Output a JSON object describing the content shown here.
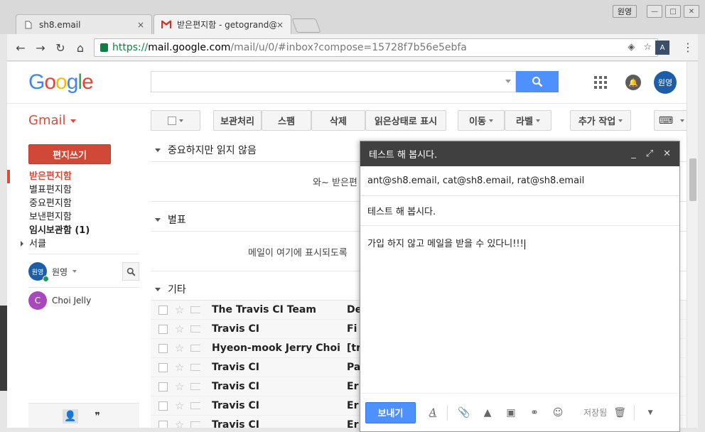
{
  "browser": {
    "tabs": [
      {
        "title": "sh8.email",
        "close": "×"
      },
      {
        "title": "받은편지함 - getogrand@",
        "close": "×"
      }
    ],
    "profile": "원영",
    "url": {
      "scheme": "https://",
      "host": "mail.google.com",
      "path": "/mail/u/0/#inbox?compose=15728f7b56e5ebfa"
    },
    "extension_label": "A"
  },
  "gmail": {
    "logo": {
      "letters": [
        "G",
        "o",
        "o",
        "g",
        "l",
        "e"
      ],
      "colors": [
        "#4285f4",
        "#ea4335",
        "#fbbc05",
        "#4285f4",
        "#34a853",
        "#ea4335"
      ]
    },
    "search_placeholder": "",
    "account_avatar": "원영",
    "app_label": "Gmail",
    "toolbar": {
      "archive": "보관처리",
      "spam": "스팸",
      "delete": "삭제",
      "mark_read": "읽은상태로 표시",
      "move": "이동",
      "labels": "라벨",
      "more": "추가 작업"
    },
    "compose_button": "편지쓰기",
    "nav": [
      {
        "label": "받은편지함"
      },
      {
        "label": "별표편지함"
      },
      {
        "label": "중요편지함"
      },
      {
        "label": "보낸편지함"
      },
      {
        "label": "임시보관함 (1)"
      },
      {
        "label": "서클"
      }
    ],
    "hangouts": {
      "me_avatar": "원영",
      "me_name": "원영",
      "contacts": [
        {
          "initial": "C",
          "name": "Choi Jelly"
        }
      ]
    },
    "sections": {
      "important_unread": {
        "title": "중요하지만 읽지 않음",
        "empty": "와~ 받은편"
      },
      "starred": {
        "title": "별표",
        "empty": "메일이 여기에 표시되도록"
      },
      "other": {
        "title": "기타"
      }
    },
    "mails": [
      {
        "sender": "The Travis CI Team",
        "subject": "De"
      },
      {
        "sender": "Travis CI",
        "subject": "Fi"
      },
      {
        "sender": "Hyeon-mook Jerry Choi",
        "subject": "[tr"
      },
      {
        "sender": "Travis CI",
        "subject": "Pa"
      },
      {
        "sender": "Travis CI",
        "subject": "Er"
      },
      {
        "sender": "Travis CI",
        "subject": "Er"
      },
      {
        "sender": "Travis CI",
        "subject": "Er"
      }
    ]
  },
  "compose": {
    "title": "테스트 해 봅시다.",
    "to": "ant@sh8.email, cat@sh8.email, rat@sh8.email",
    "subject": "테스트 해 봅시다.",
    "body": "가입 하지 않고 메일을 받을 수 있다니!!!",
    "send": "보내기",
    "saved": "저장됨"
  },
  "colors": {
    "accent_red": "#dd4b39",
    "compose_red": "#d14836",
    "blue": "#4d90fe",
    "compose_header": "#404040"
  }
}
